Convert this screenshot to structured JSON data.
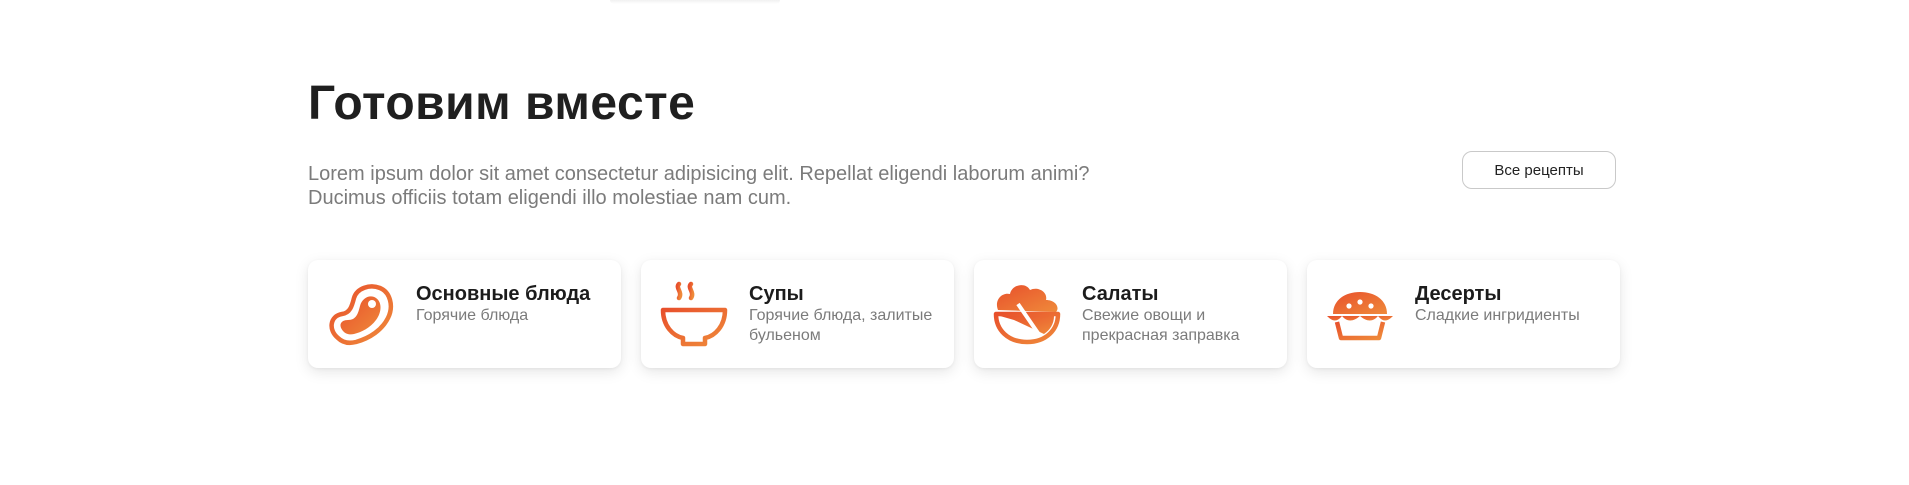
{
  "section": {
    "title": "Готовим вместе",
    "description": "Lorem ipsum dolor sit amet consectetur adipisicing elit. Repellat eligendi laborum animi? Ducimus officiis totam eligendi illo molestiae nam cum.",
    "all_button_label": "Все рецепты"
  },
  "colors": {
    "accent_start": "#e8502c",
    "accent_end": "#ef8a3a"
  },
  "categories": [
    {
      "name": "Основные блюда",
      "subtitle": "Горячие блюда",
      "icon": "steak-icon"
    },
    {
      "name": "Супы",
      "subtitle": "Горячие блюда, залитые бульеном",
      "icon": "soup-bowl-icon"
    },
    {
      "name": "Салаты",
      "subtitle": "Свежие овощи и прекрасная заправка",
      "icon": "salad-bowl-icon"
    },
    {
      "name": "Десерты",
      "subtitle": "Сладкие ингридиенты",
      "icon": "pie-icon"
    }
  ]
}
